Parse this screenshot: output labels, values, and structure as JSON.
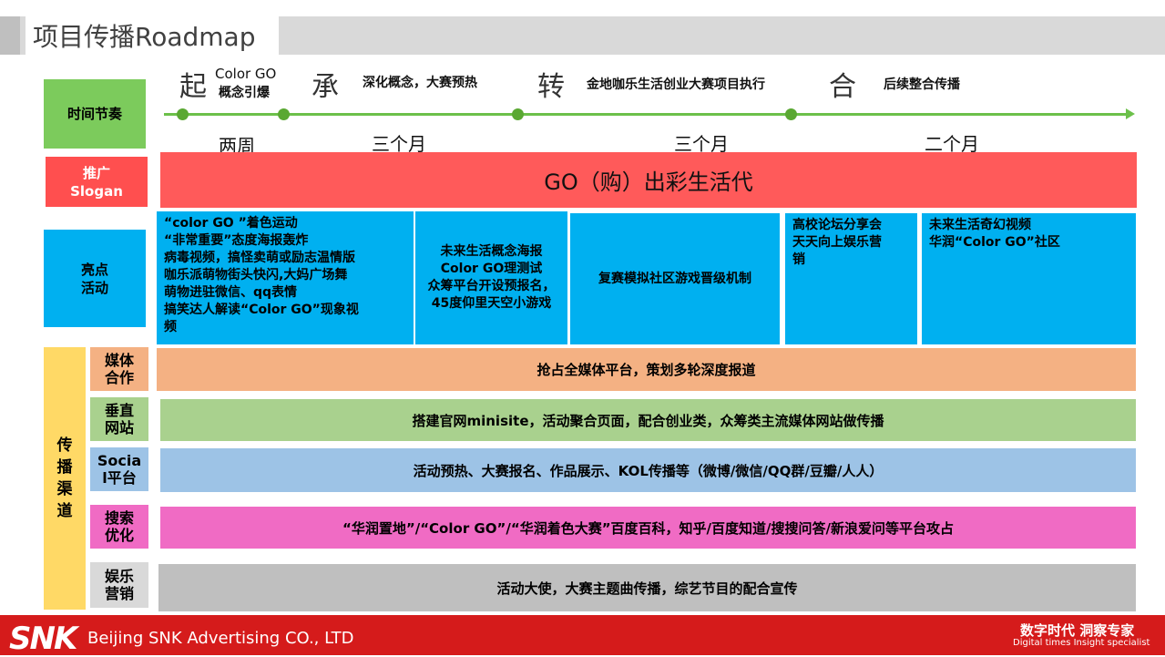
{
  "header": {
    "title": "项目传播Roadmap"
  },
  "labels": {
    "rhythm": "时间节奏",
    "slogan_line1": "推广",
    "slogan_line2": "Slogan",
    "highlight_line1": "亮点",
    "highlight_line2": "活动",
    "channels": [
      "传",
      "播",
      "渠",
      "道"
    ]
  },
  "timeline": {
    "phases": [
      {
        "char": "起",
        "line1": "Color  GO",
        "line2": "概念引爆"
      },
      {
        "char": "承",
        "text": "深化概念，大赛预热"
      },
      {
        "char": "转",
        "text": "金地咖乐生活创业大赛项目执行"
      },
      {
        "char": "合",
        "text": "后续整合传播"
      }
    ],
    "durations": [
      "两周",
      "三个月",
      "三个月",
      "二个月"
    ],
    "colors": {
      "line": "#6cc04a",
      "dot": "#5aa832"
    }
  },
  "slogan": {
    "text": "GO（购）出彩生活代"
  },
  "highlights": [
    {
      "lines": [
        "“color GO ”着色运动",
        "“非常重要”态度海报轰炸",
        "病毒视频，搞怪卖萌或励志温情版",
        "咖乐派萌物街头快闪,大妈广场舞",
        "萌物进驻微信、qq表情",
        "搞笑达人解读“Color GO”现象视",
        "频"
      ]
    },
    {
      "lines": [
        "未来生活概念海报",
        "Color  GO理测试",
        "众筹平台开设预报名，",
        "45度仰里天空小游戏"
      ]
    },
    {
      "lines": [
        "复赛模拟社区游戏晋级机制"
      ]
    },
    {
      "lines": [
        "高校论坛分享会",
        "天天向上娱乐营",
        "销"
      ]
    },
    {
      "lines": [
        "未来生活奇幻视频",
        "华润“Color GO”社区"
      ]
    }
  ],
  "channels": [
    {
      "label1": "媒体",
      "label2": "合作",
      "text": "抢占全媒体平台，策划多轮深度报道",
      "color": "#f4b183"
    },
    {
      "label1": "垂直",
      "label2": "网站",
      "text": "搭建官网minisite，活动聚合页面，配合创业类，众筹类主流媒体网站做传播",
      "color": "#a9d18e"
    },
    {
      "label1": "Socia",
      "label2": "l平台",
      "text": "活动预热、大赛报名、作品展示、KOL传播等（微博/微信/QQ群/豆瓣/人人）",
      "color": "#9dc3e6"
    },
    {
      "label1": "搜索",
      "label2": "优化",
      "text": "“华润置地”/“Color GO”/“华润着色大赛”百度百科，知乎/百度知道/搜搜问答/新浪爱问等平台攻占",
      "color": "#f06bc4"
    },
    {
      "label1": "娱乐",
      "label2": "营销",
      "text": "活动大使，大赛主题曲传播，综艺节目的配合宣传",
      "color": "#bfbfbf"
    }
  ],
  "footer": {
    "logo": "SNK",
    "company": "Beijing SNK Advertising CO., LTD",
    "slogan_cn": "数字时代 洞察专家",
    "slogan_en": "Digital times Insight specialist",
    "color": "#d51b1b"
  }
}
